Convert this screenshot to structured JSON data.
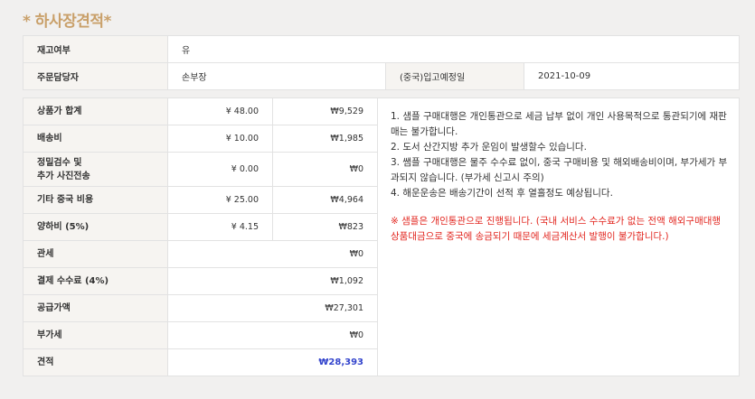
{
  "page_title": "* 하사장견적*",
  "info": {
    "stock_label": "재고여부",
    "stock_value": "유",
    "manager_label": "주문담당자",
    "manager_value": "손부장",
    "arrival_label": "(중국)입고예정일",
    "arrival_value": "2021-10-09"
  },
  "costs": [
    {
      "label": "상품가 합계",
      "cny": "¥ 48.00",
      "krw": "₩9,529"
    },
    {
      "label": "배송비",
      "cny": "¥ 10.00",
      "krw": "₩1,985"
    },
    {
      "label": "정밀검수 및\n추가 사진전송",
      "cny": "¥ 0.00",
      "krw": "₩0"
    },
    {
      "label": "기타 중국 비용",
      "cny": "¥ 25.00",
      "krw": "₩4,964"
    },
    {
      "label": "양하비 (5%)",
      "cny": "¥ 4.15",
      "krw": "₩823"
    },
    {
      "label": "관세",
      "krw": "₩0"
    },
    {
      "label": "결제 수수료 (4%)",
      "krw": "₩1,092"
    },
    {
      "label": "공급가액",
      "krw": "₩27,301"
    },
    {
      "label": "부가세",
      "krw": "₩0"
    },
    {
      "label": "견적",
      "krw": "₩28,393"
    }
  ],
  "notes": [
    "1. 샘플 구매대행은 개인통관으로 세금 납부 없이 개인 사용목적으로 통관되기에 재판매는 불가합니다.",
    "2. 도서 산간지방 추가 운임이 발생할수 있습니다.",
    "3. 쌤플 구매대행은 물주 수수료 없이, 중국 구매비용 및 해외배송비이며, 부가세가 부과되지 않습니다. (부가세 신고시 주의)",
    "4. 해운운송은 배송기간이 선적 후 열흘정도 예상됩니다."
  ],
  "warning": "※ 샘플은 개인통관으로 진행됩니다. (국내 서비스 수수료가 없는 전액 해외구매대행 상품대금으로 중국에 송금되기 때문에 세금계산서 발행이 불가합니다.)",
  "colors": {
    "accent": "#c9a06a",
    "total": "#3344cc",
    "warning": "#e2261f"
  }
}
